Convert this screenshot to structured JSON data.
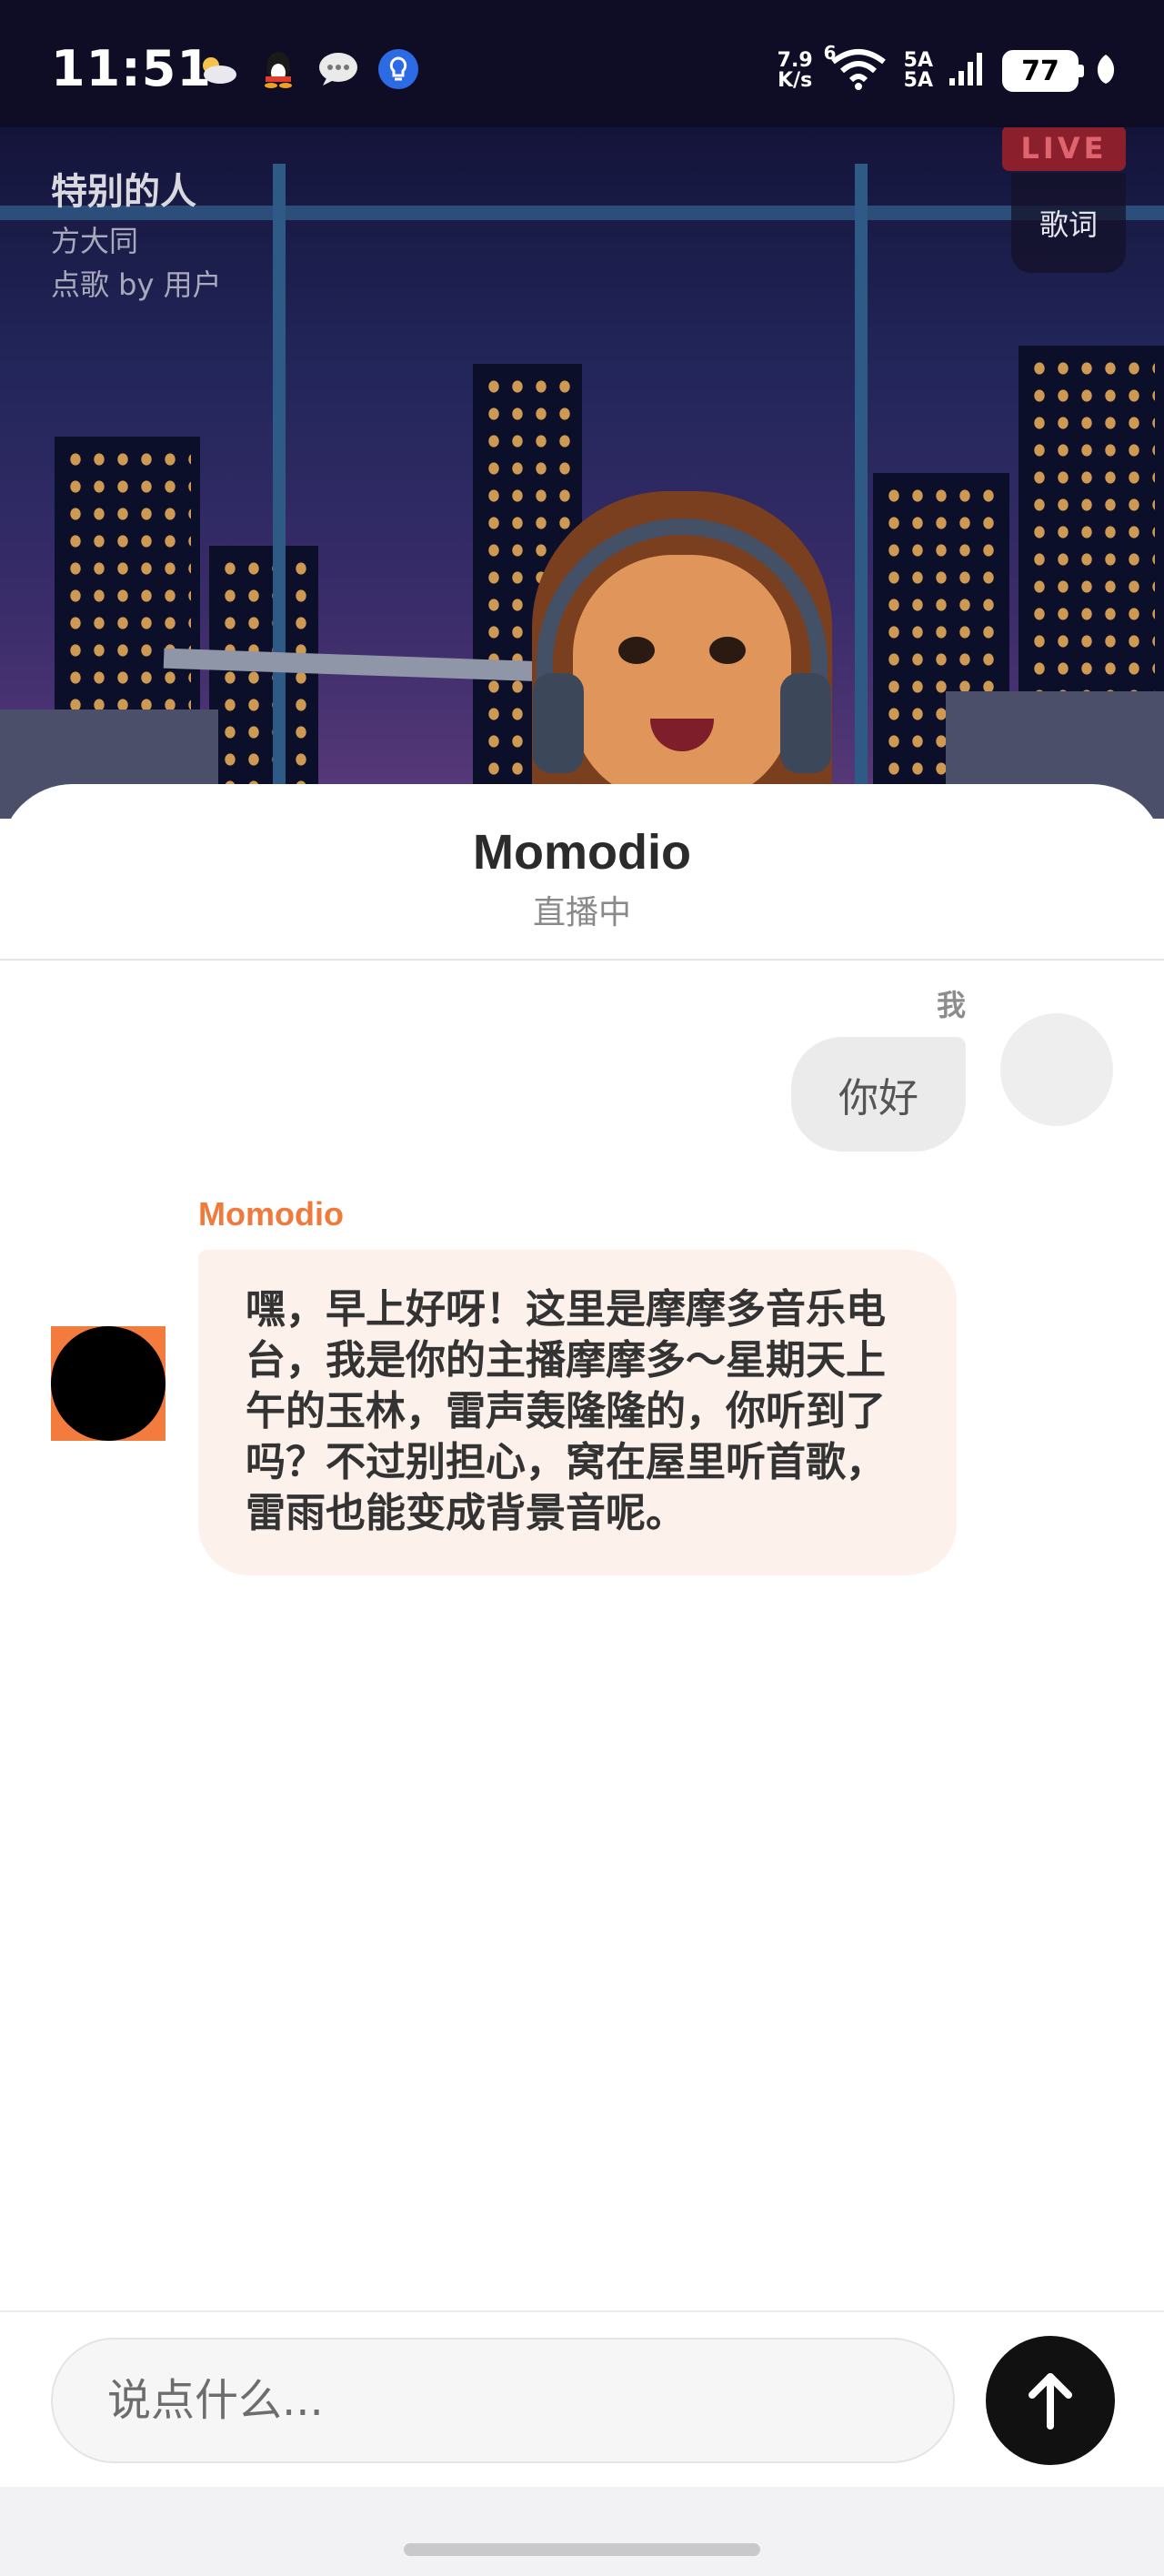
{
  "status_bar": {
    "time": "11:51",
    "net_speed_value": "7.9",
    "net_speed_unit": "K/s",
    "signal_1": "5A",
    "signal_2": "5A",
    "wifi_tag": "6",
    "battery": "77",
    "icons": [
      "weather-cloud-sun-icon",
      "qq-penguin-icon",
      "chat-bubble-icon",
      "bulb-notification-icon"
    ]
  },
  "now_playing": {
    "title": "特别的人",
    "artist": "方大同",
    "requested_by": "点歌 by 用户",
    "live_badge": "LIVE",
    "lyrics_button": "歌词"
  },
  "chat": {
    "station_name": "Momodio",
    "station_status": "直播中",
    "messages": [
      {
        "sender": "我",
        "text": "你好",
        "side": "right"
      },
      {
        "sender": "Momodio",
        "text": "嘿，早上好呀！这里是摩摩多音乐电台，我是你的主播摩摩多～星期天上午的玉林，雷声轰隆隆的，你听到了吗？不过别担心，窝在屋里听首歌，雷雨也能变成背景音呢。",
        "side": "left"
      }
    ]
  },
  "composer": {
    "placeholder": "说点什么...",
    "value": "",
    "send_icon": "arrow-up-icon"
  },
  "colors": {
    "accent": "#f07a3c",
    "bot_bubble": "#fdf1ec",
    "user_bubble": "#ebebeb",
    "send_button": "#111111",
    "status_bar_bg": "#0f0c26"
  }
}
